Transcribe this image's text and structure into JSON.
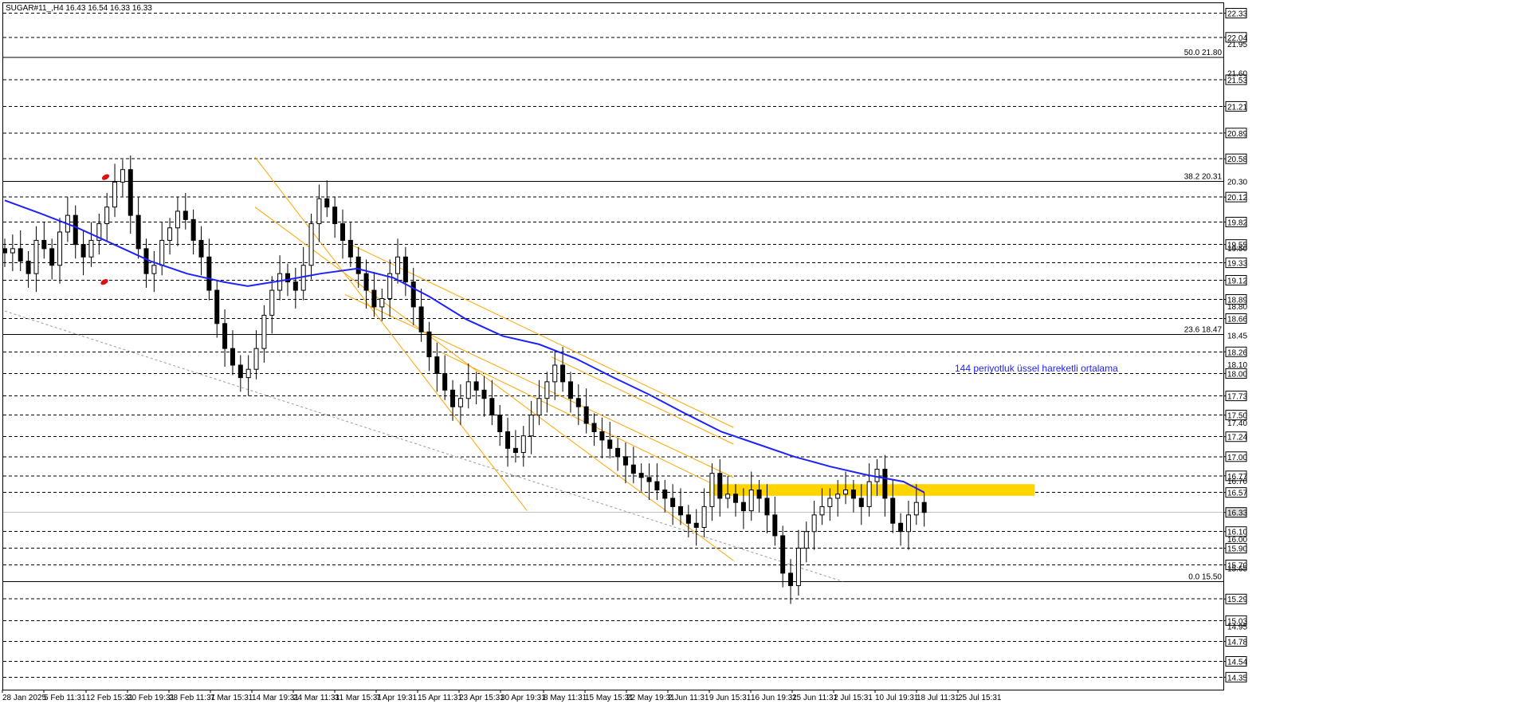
{
  "header": {
    "symbol_ohlc": "SUGAR#11_,H4  16.43 16.54 16.33 16.33"
  },
  "chart_data": {
    "type": "candlestick",
    "symbol": "SUGAR#11_",
    "timeframe": "H4",
    "ylim": [
      14.2,
      22.45
    ],
    "grid": "horizontal dashed",
    "x_tick_labels": [
      "28 Jan 2025",
      "5 Feb 11:31",
      "12 Feb 15:31",
      "20 Feb 19:31",
      "28 Feb 11:31",
      "7 Mar 15:31",
      "14 Mar 19:31",
      "24 Mar 11:31",
      "31 Mar 15:31",
      "7 Apr 19:31",
      "15 Apr 11:31",
      "23 Apr 15:31",
      "30 Apr 19:31",
      "8 May 11:31",
      "15 May 15:31",
      "22 May 19:31",
      "2 Jun 11:31",
      "9 Jun 15:31",
      "16 Jun 19:31",
      "25 Jun 11:31",
      "2 Jul 15:31",
      "10 Jul 19:31",
      "18 Jul 11:31",
      "25 Jul 15:31"
    ],
    "y_boxed_labels": [
      22.33,
      22.04,
      21.53,
      21.21,
      20.89,
      20.58,
      20.12,
      19.82,
      19.55,
      19.33,
      19.12,
      18.89,
      18.66,
      18.26,
      18.0,
      17.73,
      17.5,
      17.24,
      17.0,
      16.77,
      16.57,
      16.33,
      16.1,
      15.9,
      15.7,
      15.29,
      15.03,
      14.78,
      14.54,
      14.35
    ],
    "y_small_labels": [
      21.95,
      21.6,
      20.3,
      19.5,
      18.8,
      18.45,
      18.1,
      17.4,
      16.7,
      16.0,
      15.65,
      14.95
    ],
    "fib_levels": [
      {
        "label": "50.0 21.80",
        "value": 21.8
      },
      {
        "label": "38.2 20.31",
        "value": 20.31
      },
      {
        "label": "23.6 18.47",
        "value": 18.47
      },
      {
        "label": "0.0 15.50",
        "value": 15.5
      }
    ],
    "current_price": 16.33,
    "ema_label": "144 periyotluk üssel hareketli ortalama",
    "ema_path": [
      [
        0,
        20.08
      ],
      [
        0.03,
        19.92
      ],
      [
        0.06,
        19.75
      ],
      [
        0.09,
        19.55
      ],
      [
        0.12,
        19.35
      ],
      [
        0.15,
        19.2
      ],
      [
        0.18,
        19.1
      ],
      [
        0.2,
        19.05
      ],
      [
        0.23,
        19.12
      ],
      [
        0.26,
        19.2
      ],
      [
        0.29,
        19.26
      ],
      [
        0.32,
        19.15
      ],
      [
        0.35,
        18.92
      ],
      [
        0.38,
        18.65
      ],
      [
        0.41,
        18.45
      ],
      [
        0.44,
        18.35
      ],
      [
        0.47,
        18.18
      ],
      [
        0.5,
        17.96
      ],
      [
        0.53,
        17.75
      ],
      [
        0.56,
        17.52
      ],
      [
        0.59,
        17.3
      ],
      [
        0.62,
        17.15
      ],
      [
        0.65,
        17.0
      ],
      [
        0.68,
        16.88
      ],
      [
        0.71,
        16.78
      ],
      [
        0.74,
        16.7
      ],
      [
        0.757,
        16.57
      ]
    ],
    "resistance_zone": {
      "from": 16.53,
      "to": 16.67,
      "x_from": 0.58,
      "x_to": 0.848
    },
    "series": [
      {
        "name": "H4",
        "close": [
          19.45,
          19.5,
          19.35,
          19.2,
          19.6,
          19.5,
          19.3,
          19.7,
          19.9,
          19.55,
          19.4,
          19.6,
          19.8,
          20.0,
          20.3,
          20.45,
          19.9,
          19.5,
          19.2,
          19.3,
          19.6,
          19.75,
          19.95,
          19.85,
          19.6,
          19.4,
          19.0,
          18.6,
          18.3,
          18.1,
          17.95,
          18.05,
          18.3,
          18.7,
          19.0,
          19.2,
          19.1,
          19.0,
          19.3,
          19.8,
          20.1,
          20.0,
          19.8,
          19.6,
          19.4,
          19.2,
          19.0,
          18.8,
          18.9,
          19.2,
          19.4,
          19.1,
          18.8,
          18.5,
          18.2,
          18.0,
          17.8,
          17.6,
          17.7,
          17.9,
          17.8,
          17.7,
          17.5,
          17.3,
          17.1,
          17.05,
          17.25,
          17.5,
          17.7,
          17.9,
          18.1,
          17.9,
          17.7,
          17.6,
          17.4,
          17.3,
          17.2,
          17.1,
          17.0,
          16.9,
          16.8,
          16.75,
          16.7,
          16.6,
          16.5,
          16.4,
          16.3,
          16.2,
          16.15,
          16.4,
          16.8,
          16.5,
          16.55,
          16.45,
          16.35,
          16.6,
          16.5,
          16.3,
          16.05,
          15.6,
          15.45,
          15.9,
          16.1,
          16.3,
          16.4,
          16.5,
          16.55,
          16.6,
          16.5,
          16.4,
          16.7,
          16.85,
          16.5,
          16.2,
          16.1,
          16.3,
          16.45,
          16.33
        ]
      }
    ]
  }
}
